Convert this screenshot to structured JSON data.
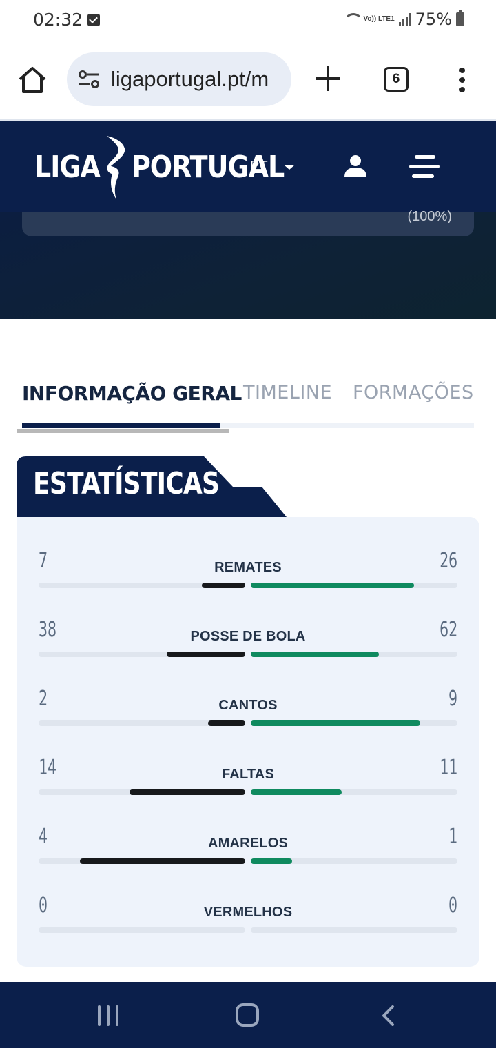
{
  "status_bar": {
    "time": "02:32",
    "network_label": "Vo)) LTE1",
    "battery": "75%"
  },
  "browser": {
    "url": "ligaportugal.pt/m",
    "tab_count": "6",
    "icons": [
      "home-icon",
      "site-settings-icon",
      "new-tab-icon",
      "tab-switcher-icon",
      "overflow-menu-icon"
    ]
  },
  "site_header": {
    "logo_left": "LIGA",
    "logo_right": "PORTUGAL",
    "language": "PT",
    "icons": [
      "user-icon",
      "hamburger-menu-icon"
    ],
    "background": "#0b1f4b"
  },
  "hero": {
    "percentage": "(100%)"
  },
  "tabs": [
    {
      "label": "INFORMAÇÃO GERAL",
      "active": true
    },
    {
      "label": "TIMELINE",
      "active": false
    },
    {
      "label": "FORMAÇÕES",
      "active": false
    }
  ],
  "stats": {
    "title": "ESTATÍSTICAS",
    "home_color": "#17191c",
    "away_color": "#0f8a5f",
    "rows": [
      {
        "label": "REMATES",
        "home": "7",
        "away": "26",
        "home_fill": 0.21,
        "away_fill": 0.79
      },
      {
        "label": "POSSE DE BOLA",
        "home": "38",
        "away": "62",
        "home_fill": 0.38,
        "away_fill": 0.62
      },
      {
        "label": "CANTOS",
        "home": "2",
        "away": "9",
        "home_fill": 0.18,
        "away_fill": 0.82
      },
      {
        "label": "FALTAS",
        "home": "14",
        "away": "11",
        "home_fill": 0.56,
        "away_fill": 0.44
      },
      {
        "label": "AMARELOS",
        "home": "4",
        "away": "1",
        "home_fill": 0.8,
        "away_fill": 0.2
      },
      {
        "label": "VERMELHOS",
        "home": "0",
        "away": "0",
        "home_fill": 0,
        "away_fill": 0
      }
    ]
  },
  "nav_bar": {
    "icons": [
      "recent-apps-icon",
      "home-icon",
      "back-icon"
    ]
  }
}
